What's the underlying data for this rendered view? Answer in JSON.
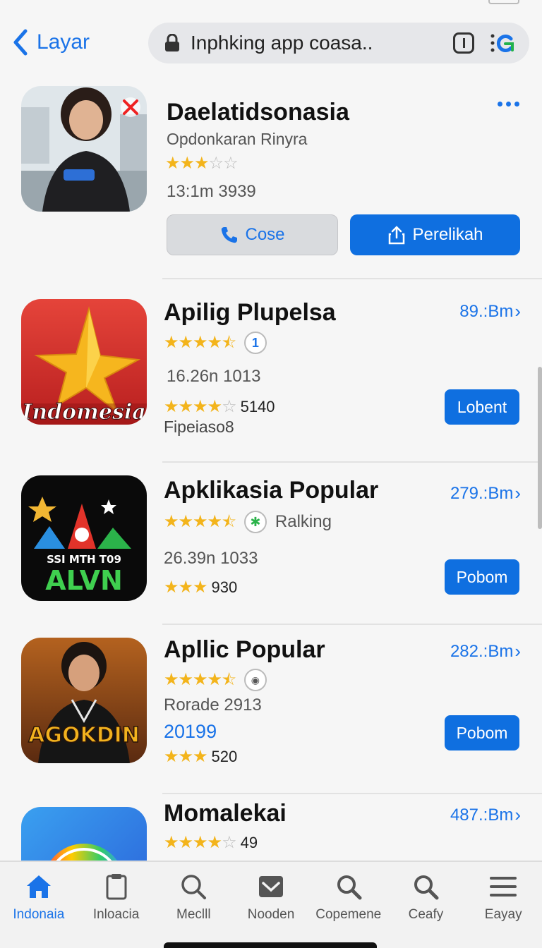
{
  "nav": {
    "back_label": "Layar",
    "url_text": "Inphking app coasa.."
  },
  "featured": {
    "title": "Daelatidsonasia",
    "subtitle": "Opdonkaran Rinyra",
    "rating": 3,
    "meta": "13:1m 3939",
    "call_button": "Cose",
    "share_button": "Perelikah"
  },
  "apps": [
    {
      "title": "Apilig Plupelsa",
      "size": "89.:Bm",
      "rating": 4.5,
      "badge_glyph": "1",
      "meta": "16.26n 1013",
      "rating2": 4,
      "rating2_label": "5140",
      "sub": "Fipeiaso8",
      "button": "Lobent",
      "icon_text": "Indomesia"
    },
    {
      "title": "Apklikasia Popular",
      "size": "279.:Bm",
      "rating": 4.5,
      "badge_glyph": "✱",
      "badge_label": "Ralking",
      "meta": "26.39n 1033",
      "rating2": 3,
      "rating2_label": "930",
      "button": "Pobom",
      "icon_text_top": "SSI  MTH  T09",
      "icon_text_bottom": "ALVN"
    },
    {
      "title": "Apllic Popular",
      "size": "282.:Bm",
      "rating": 4.5,
      "badge_glyph": "◉",
      "meta": "Rorade 2913",
      "price": "20199",
      "rating2": 3,
      "rating2_label": "520",
      "button": "Pobom",
      "icon_text": "AGOKDIN"
    },
    {
      "title": "Momalekai",
      "size": "487.:Bm",
      "rating": 4,
      "rating_label": "49"
    }
  ],
  "tabs": [
    {
      "label": "Indonaia",
      "icon": "home-icon",
      "active": true
    },
    {
      "label": "Inloacia",
      "icon": "clipboard-icon",
      "active": false
    },
    {
      "label": "Meclll",
      "icon": "search-icon",
      "active": false
    },
    {
      "label": "Nooden",
      "icon": "mail-icon",
      "active": false
    },
    {
      "label": "Copemene",
      "icon": "search-icon",
      "active": false
    },
    {
      "label": "Ceafy",
      "icon": "search-icon",
      "active": false
    },
    {
      "label": "Eayay",
      "icon": "menu-icon",
      "active": false
    }
  ],
  "colors": {
    "accent": "#1a73e8",
    "button": "#0f6fe0",
    "star": "#f3b41b"
  }
}
